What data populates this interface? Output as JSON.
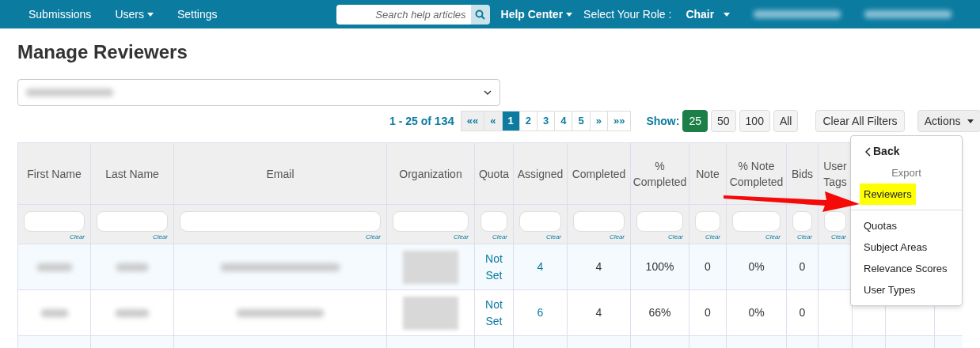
{
  "nav": {
    "items": [
      {
        "label": "Submissions",
        "dropdown": false
      },
      {
        "label": "Users",
        "dropdown": true
      },
      {
        "label": "Settings",
        "dropdown": false
      }
    ],
    "search": {
      "placeholder": "Search help articles"
    },
    "help_center": {
      "label": "Help Center",
      "dropdown": true
    },
    "role_label": "Select Your Role :",
    "role": {
      "label": "Chair",
      "dropdown": true
    }
  },
  "page_title": "Manage Reviewers",
  "pagination": {
    "range": "1 - 25 of",
    "total": "134",
    "pages": [
      {
        "label": "««",
        "selected": false
      },
      {
        "label": "«",
        "selected": false
      },
      {
        "label": "1",
        "selected": true
      },
      {
        "label": "2",
        "selected": false
      },
      {
        "label": "3",
        "selected": false
      },
      {
        "label": "4",
        "selected": false
      },
      {
        "label": "5",
        "selected": false
      },
      {
        "label": "»",
        "selected": false
      },
      {
        "label": "»»",
        "selected": false
      }
    ],
    "show_label": "Show:",
    "sizes": [
      {
        "label": "25",
        "selected": true
      },
      {
        "label": "50",
        "selected": false
      },
      {
        "label": "100",
        "selected": false
      },
      {
        "label": "All",
        "selected": false
      }
    ],
    "clear_filters": "Clear All Filters",
    "actions": "Actions"
  },
  "table": {
    "columns": [
      {
        "label": "First Name",
        "clear": "Clear"
      },
      {
        "label": "Last Name",
        "clear": "Clear"
      },
      {
        "label": "Email",
        "clear": "Clear"
      },
      {
        "label": "Organization",
        "clear": "Clear"
      },
      {
        "label": "Quota",
        "clear": "Clear"
      },
      {
        "label": "Assigned",
        "clear": "Clear"
      },
      {
        "label": "Completed",
        "clear": "Clear"
      },
      {
        "label": "% Completed",
        "clear": "Clear"
      },
      {
        "label": "Note",
        "clear": "Clear"
      },
      {
        "label": "% Note Completed",
        "clear": "Clear"
      },
      {
        "label": "Bids",
        "clear": "Clear"
      },
      {
        "label": "User Tags",
        "clear": "Clear"
      }
    ],
    "rows": [
      {
        "quota": "Not Set",
        "assigned": "4",
        "completed": "4",
        "pct_completed": "100%",
        "note": "0",
        "pct_note": "0%",
        "bids": "0"
      },
      {
        "quota": "Not Set",
        "assigned": "6",
        "completed": "4",
        "pct_completed": "66%",
        "note": "0",
        "pct_note": "0%",
        "bids": "0"
      }
    ]
  },
  "menu": {
    "items": [
      {
        "kind": "back",
        "label": "Back",
        "selected": false
      },
      {
        "kind": "header",
        "label": "Export",
        "selected": false
      },
      {
        "kind": "item",
        "label": "Reviewers",
        "selected": true
      },
      {
        "kind": "divider"
      },
      {
        "kind": "item",
        "label": "Quotas",
        "selected": false
      },
      {
        "kind": "item",
        "label": "Subject Areas",
        "selected": false
      },
      {
        "kind": "item",
        "label": "Relevance Scores",
        "selected": false
      },
      {
        "kind": "item",
        "label": "User Types",
        "selected": false
      }
    ]
  }
}
